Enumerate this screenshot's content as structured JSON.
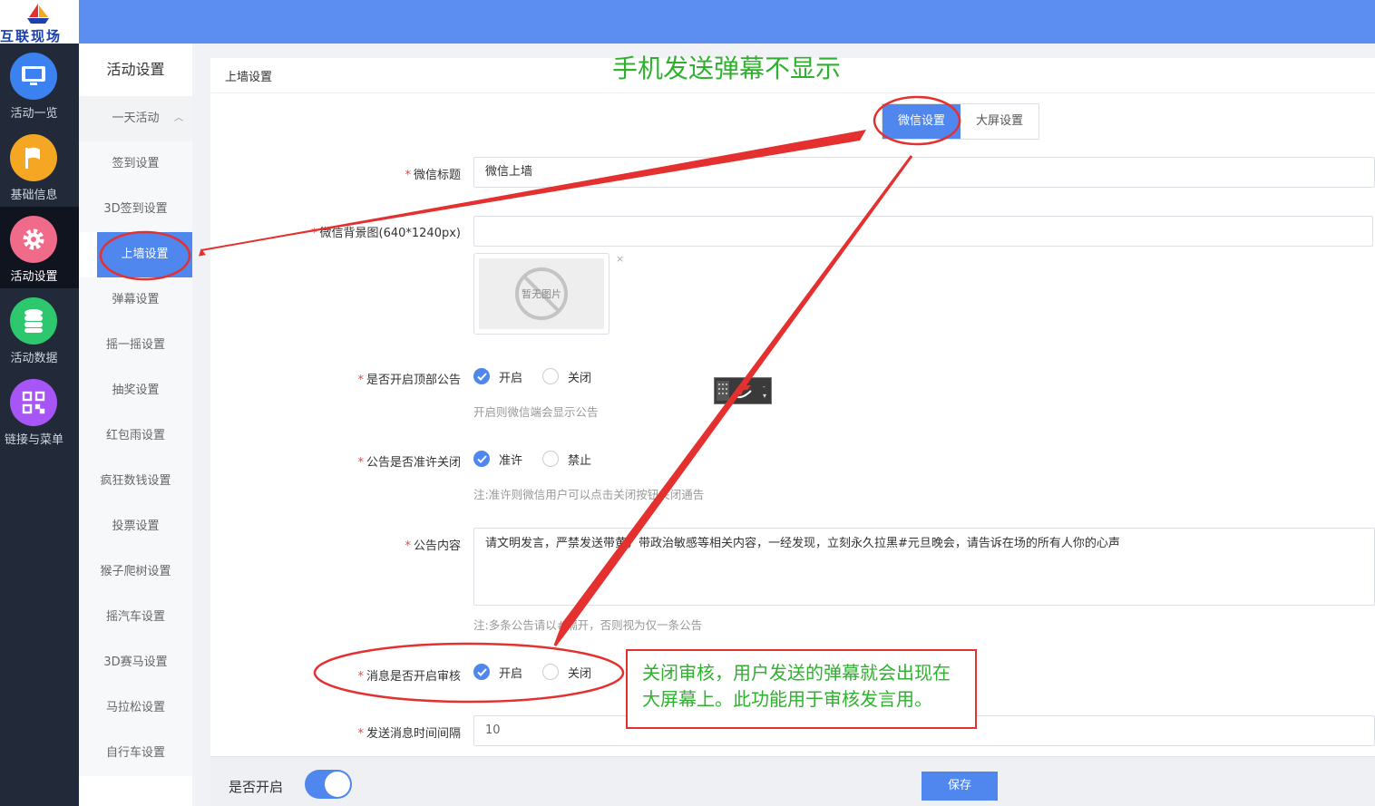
{
  "brand": {
    "text": "互联现场"
  },
  "nav": [
    {
      "label": "活动一览",
      "icon": "monitor-icon",
      "color": "#3b82f0"
    },
    {
      "label": "基础信息",
      "icon": "flag-icon",
      "color": "#f5a623"
    },
    {
      "label": "活动设置",
      "icon": "gear-icon",
      "color": "#f06a8a",
      "active": true
    },
    {
      "label": "活动数据",
      "icon": "database-icon",
      "color": "#2dc76d"
    },
    {
      "label": "链接与菜单",
      "icon": "qrcode-icon",
      "color": "#a855f7"
    }
  ],
  "subnav": {
    "header": "活动设置",
    "group": "一天活动",
    "items": [
      "签到设置",
      "3D签到设置",
      "上墙设置",
      "弹幕设置",
      "摇一摇设置",
      "抽奖设置",
      "红包雨设置",
      "疯狂数钱设置",
      "投票设置",
      "猴子爬树设置",
      "摇汽车设置",
      "3D赛马设置",
      "马拉松设置",
      "自行车设置"
    ],
    "active": "上墙设置"
  },
  "page": {
    "title": "上墙设置"
  },
  "tabs": [
    {
      "label": "微信设置",
      "active": true
    },
    {
      "label": "大屏设置",
      "active": false
    }
  ],
  "form": {
    "wechat_title": {
      "label": "微信标题",
      "value": "微信上墙"
    },
    "wechat_bg": {
      "label": "微信背景图(640*1240px)",
      "value": "",
      "no_image_text": "暂无图片",
      "remove": "×"
    },
    "top_notice": {
      "label": "是否开启顶部公告",
      "options": [
        "开启",
        "关闭"
      ],
      "selected": "开启",
      "hint": "开启则微信端会显示公告"
    },
    "notice_close": {
      "label": "公告是否准许关闭",
      "options": [
        "准许",
        "禁止"
      ],
      "selected": "准许",
      "hint": "注:准许则微信用户可以点击关闭按钮关闭通告"
    },
    "notice_content": {
      "label": "公告内容",
      "value": "请文明发言，严禁发送带黄，带政治敏感等相关内容，一经发现，立刻永久拉黑#元旦晚会，请告诉在场的所有人你的心声",
      "hint": "注:多条公告请以#隔开，否则视为仅一条公告"
    },
    "msg_review": {
      "label": "消息是否开启审核",
      "options": [
        "开启",
        "关闭"
      ],
      "selected": "开启"
    },
    "msg_interval": {
      "label": "发送消息时间间隔",
      "value": "10"
    }
  },
  "footer": {
    "enable_label": "是否开启",
    "enabled": true,
    "save_label": "保存"
  },
  "annotations": {
    "title": "手机发送弹幕不显示",
    "note": [
      "关闭审核，用户发送的弹幕就会出现在",
      "大屏幕上。此功能用于审核发言用。"
    ],
    "color_text": "#2fb12f",
    "color_marker": "#e53030"
  }
}
